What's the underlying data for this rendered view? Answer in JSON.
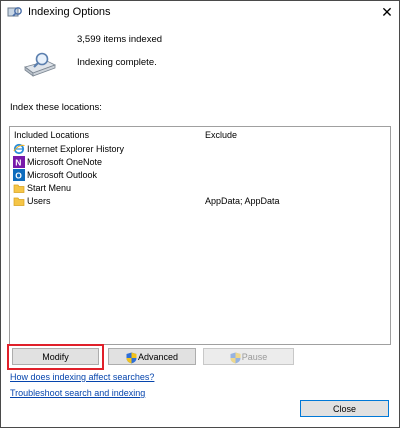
{
  "window": {
    "title": "Indexing Options"
  },
  "summary": {
    "items_indexed": "3,599 items indexed",
    "status": "Indexing complete."
  },
  "locations": {
    "label": "Index these locations:",
    "headers": {
      "included": "Included Locations",
      "exclude": "Exclude"
    },
    "rows": [
      {
        "icon": "internet-explorer-icon",
        "name": "Internet Explorer History",
        "exclude": ""
      },
      {
        "icon": "onenote-icon",
        "name": "Microsoft OneNote",
        "exclude": ""
      },
      {
        "icon": "outlook-icon",
        "name": "Microsoft Outlook",
        "exclude": ""
      },
      {
        "icon": "folder-icon",
        "name": "Start Menu",
        "exclude": ""
      },
      {
        "icon": "folder-icon",
        "name": "Users",
        "exclude": "AppData; AppData"
      }
    ]
  },
  "buttons": {
    "modify": "Modify",
    "advanced": "Advanced",
    "pause": "Pause",
    "close": "Close"
  },
  "links": {
    "how_indexing": "How does indexing affect searches?",
    "troubleshoot": "Troubleshoot search and indexing"
  },
  "colors": {
    "link": "#0645ad",
    "highlight": "#e0202a",
    "close_border": "#0078d7"
  }
}
